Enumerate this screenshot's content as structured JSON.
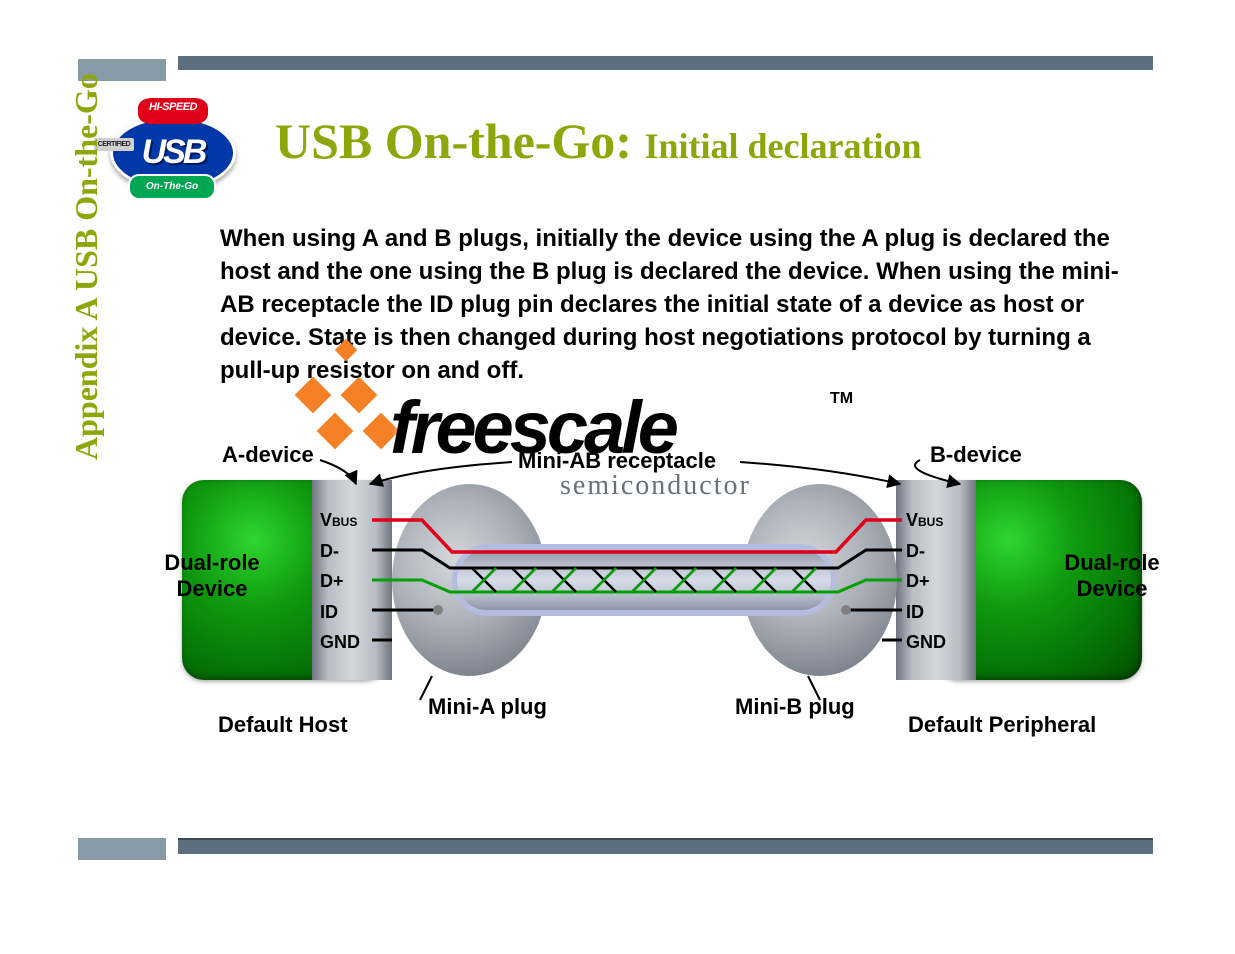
{
  "side_label": "Appendix A USB On-the-Go",
  "title": {
    "main": "USB On-the-Go: ",
    "sub": "Initial declaration"
  },
  "body": "When using A and B plugs, initially the device using the A plug is declared the host and the one using the B plug is declared the device. When using the mini-AB receptacle the ID plug pin declares the initial state of a device as host or device. State is then changed during host negotiations protocol by turning a pull-up resistor on and off.",
  "usb_logo": {
    "hi_speed": "HI-SPEED",
    "certified": "CERTIFIED",
    "usb": "USB",
    "otg": "On-The-Go"
  },
  "watermark": {
    "brand": "freescale",
    "tm": "TM",
    "sub": "semiconductor"
  },
  "diagram": {
    "a_device": "A-device",
    "b_device": "B-device",
    "receptacle": "Mini-AB receptacle",
    "mini_a_plug": "Mini-A plug",
    "mini_b_plug": "Mini-B plug",
    "default_host": "Default Host",
    "default_peripheral": "Default Peripheral",
    "dual_role": "Dual-role Device",
    "pins": {
      "vbus": "V",
      "vbus_sub": "BUS",
      "dminus": "D-",
      "dplus": "D+",
      "id": "ID",
      "gnd": "GND"
    }
  }
}
